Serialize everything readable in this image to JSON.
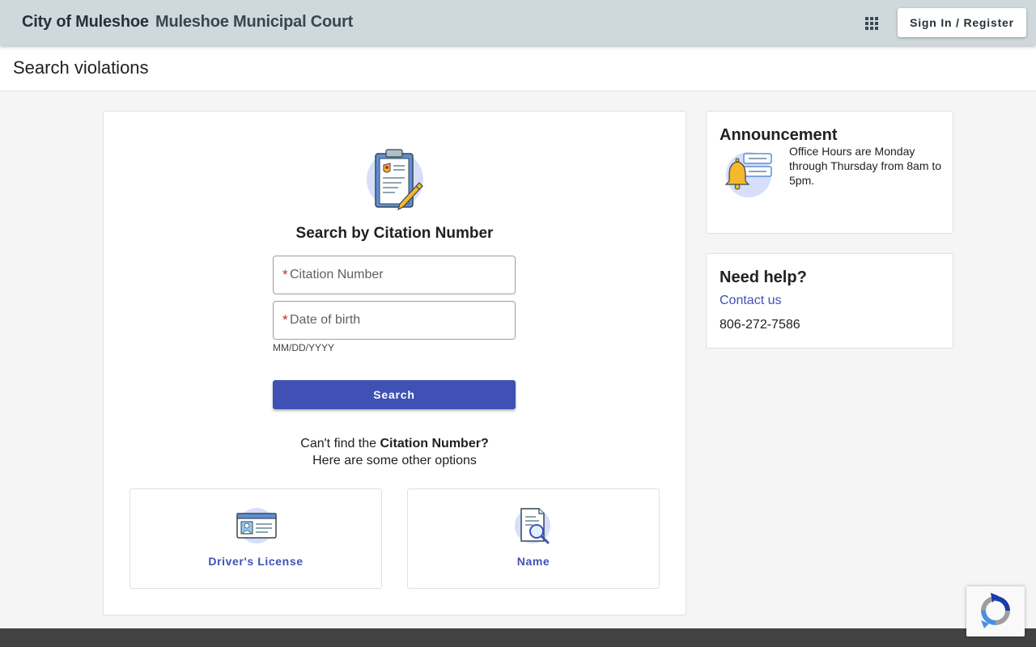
{
  "header": {
    "brand": "City of Muleshoe",
    "court_name": "Muleshoe Municipal Court",
    "apps_icon": "apps-grid-icon",
    "signin_label": "Sign In / Register"
  },
  "page": {
    "title": "Search violations"
  },
  "search": {
    "icon": "clipboard-badge-icon",
    "title": "Search by Citation Number",
    "citation_placeholder": "Citation Number",
    "citation_value": "",
    "dob_placeholder": "Date of birth",
    "dob_value": "",
    "required_marker": "*",
    "dob_hint": "MM/DD/YYYY",
    "button_label": "Search",
    "cant_find_prefix": "Can't find the ",
    "cant_find_bold": "Citation Number?",
    "other_options": "Here are some other options"
  },
  "options": [
    {
      "label": "Driver's License",
      "icon": "id-card-icon"
    },
    {
      "label": "Name",
      "icon": "document-search-icon"
    }
  ],
  "announcement": {
    "title": "Announcement",
    "icon": "bell-notification-icon",
    "text": "Office Hours are Monday through Thursday from 8am to 5pm."
  },
  "help": {
    "title": "Need help?",
    "contact_label": "Contact us",
    "phone": "806-272-7586"
  },
  "colors": {
    "accent": "#3f51b5",
    "topbar": "#cfd8dc",
    "required": "#c62828",
    "footer": "#424242"
  }
}
